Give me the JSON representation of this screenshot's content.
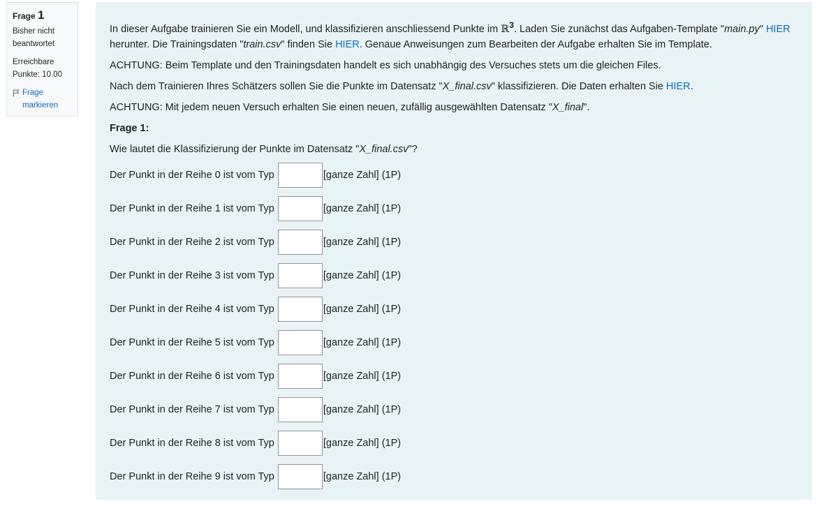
{
  "info": {
    "label": "Frage",
    "number": "1",
    "state": "Bisher nicht beantwortet",
    "grade": "Erreichbare Punkte: 10.00",
    "flag_label": "Frage markieren"
  },
  "intro": {
    "p1_a": "In dieser Aufgabe trainieren Sie ein Modell, und klassifizieren anschliessend Punkte im ",
    "p1_rsym": "ℝ",
    "p1_exp": "3",
    "p1_b": ". Laden Sie zunächst das Aufgaben-Template \"",
    "p1_main": "main.py",
    "p1_c": "\" ",
    "p1_link1": "HIER",
    "p1_d": " herunter. Die Trainingsdaten \"",
    "p1_train": "train.csv",
    "p1_e": "\" finden Sie ",
    "p1_link2": "HIER",
    "p1_f": ". Genaue Anweisungen zum Bearbeiten der Aufgabe erhalten Sie im Template.",
    "p2": "ACHTUNG: Beim Template und den Trainingsdaten handelt es sich unabhängig des Versuches stets um die gleichen Files.",
    "p3_a": "Nach dem Trainieren Ihres Schätzers sollen Sie die Punkte im Datensatz \"",
    "p3_file": "X_final.csv",
    "p3_b": "\" klassifizieren. Die Daten erhalten Sie ",
    "p3_link": "HIER",
    "p3_c": ".",
    "p4_a": "ACHTUNG: Mit jedem neuen Versuch erhalten Sie einen neuen, zufällig ausgewählten Datensatz \"",
    "p4_file": "X_final",
    "p4_b": "\"."
  },
  "question": {
    "heading": "Frage 1:",
    "text_a": "Wie lautet die Klassifizierung der Punkte im Datensatz \"",
    "text_file": "X_final.csv",
    "text_b": "\"?",
    "hint": "[ganze Zahl] (1P)",
    "rows": [
      {
        "label": "Der Punkt in der Reihe 0 ist vom Typ",
        "value": ""
      },
      {
        "label": "Der Punkt in der Reihe 1 ist vom Typ",
        "value": ""
      },
      {
        "label": "Der Punkt in der Reihe 2 ist vom Typ",
        "value": ""
      },
      {
        "label": "Der Punkt in der Reihe 3 ist vom Typ",
        "value": ""
      },
      {
        "label": "Der Punkt in der Reihe 4 ist vom Typ",
        "value": ""
      },
      {
        "label": "Der Punkt in der Reihe 5 ist vom Typ",
        "value": ""
      },
      {
        "label": "Der Punkt in der Reihe 6 ist vom Typ",
        "value": ""
      },
      {
        "label": "Der Punkt in der Reihe 7 ist vom Typ",
        "value": ""
      },
      {
        "label": "Der Punkt in der Reihe 8 ist vom Typ",
        "value": ""
      },
      {
        "label": "Der Punkt in der Reihe 9 ist vom Typ",
        "value": ""
      }
    ]
  },
  "colors": {
    "link": "#0f6cbf",
    "content_bg": "#e7f3f5",
    "info_bg": "#f8f9fa"
  }
}
